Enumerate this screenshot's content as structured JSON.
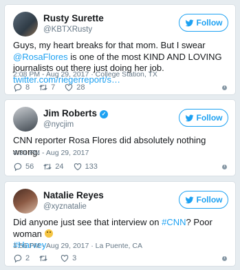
{
  "follow_label": "Follow",
  "tweets": [
    {
      "name": "Rusty Surette",
      "handle": "@KBTXRusty",
      "text_parts": [
        "Guys, my heart breaks for that mom. But I swear ",
        "@RosaFlores",
        " is one of the most KIND AND LOVING journalists out there just doing her job. ",
        "twitter.com/riegerreport/s…"
      ],
      "meta": "2:08 PM - Aug 29, 2017 · College Station, TX",
      "replies": "8",
      "retweets": "7",
      "likes": "28"
    },
    {
      "name": "Jim Roberts",
      "handle": "@nycjim",
      "text": "CNN reporter Rosa Flores did absolutely nothing wrong.",
      "meta": "4:31 PM - Aug 29, 2017",
      "replies": "56",
      "retweets": "24",
      "likes": "133"
    },
    {
      "name": "Natalie Reyes",
      "handle": "@xyznatalie",
      "text_parts": [
        "Did anyone just see that interview on ",
        "#CNN",
        "? Poor woman ",
        "#Harvey"
      ],
      "meta": "1:56 PM - Aug 29, 2017 · La Puente, CA",
      "replies": "2",
      "retweets": "",
      "likes": "3"
    }
  ],
  "colors": {
    "accent": "#1da1f2",
    "muted": "#657786",
    "background": "#e6ecf0"
  }
}
